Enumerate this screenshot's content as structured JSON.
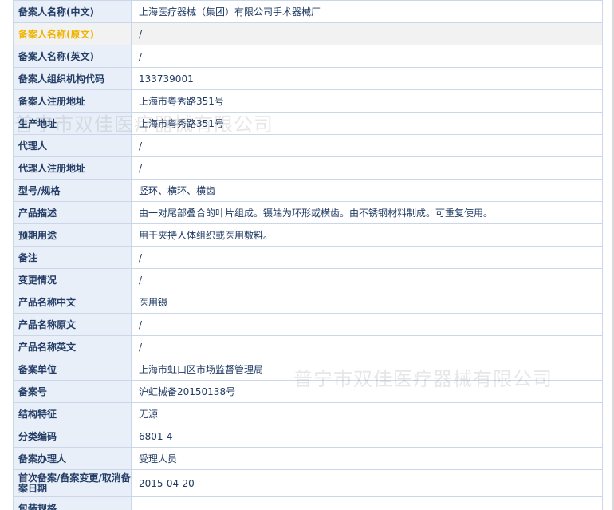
{
  "rows": [
    {
      "label": "备案人名称(中文)",
      "value": "上海医疗器械（集团）有限公司手术器械厂",
      "highlight": false
    },
    {
      "label": "备案人名称(原文)",
      "value": "/",
      "highlight": true
    },
    {
      "label": "备案人名称(英文)",
      "value": "/",
      "highlight": false
    },
    {
      "label": "备案人组织机构代码",
      "value": "133739001",
      "highlight": false
    },
    {
      "label": "备案人注册地址",
      "value": "上海市粤秀路351号",
      "highlight": false
    },
    {
      "label": "生产地址",
      "value": "上海市粤秀路351号",
      "highlight": false
    },
    {
      "label": "代理人",
      "value": "/",
      "highlight": false
    },
    {
      "label": "代理人注册地址",
      "value": "/",
      "highlight": false
    },
    {
      "label": "型号/规格",
      "value": "竖环、横环、横齿",
      "highlight": false
    },
    {
      "label": "产品描述",
      "value": "由一对尾部叠合的叶片组成。镊端为环形或横齿。由不锈钢材料制成。可重复使用。",
      "highlight": false
    },
    {
      "label": "预期用途",
      "value": "用于夹持人体组织或医用敷料。",
      "highlight": false
    },
    {
      "label": "备注",
      "value": "/",
      "highlight": false
    },
    {
      "label": "变更情况",
      "value": "/",
      "highlight": false
    },
    {
      "label": "产品名称中文",
      "value": "医用镊",
      "highlight": false
    },
    {
      "label": "产品名称原文",
      "value": "/",
      "highlight": false
    },
    {
      "label": "产品名称英文",
      "value": "/",
      "highlight": false
    },
    {
      "label": "备案单位",
      "value": "上海市虹口区市场监督管理局",
      "highlight": false
    },
    {
      "label": "备案号",
      "value": "沪虹械备20150138号",
      "highlight": false
    },
    {
      "label": "结构特征",
      "value": "无源",
      "highlight": false
    },
    {
      "label": "分类编码",
      "value": "6801-4",
      "highlight": false
    },
    {
      "label": "备案办理人",
      "value": "受理人员",
      "highlight": false
    },
    {
      "label": "首次备案/备案变更/取消备案日期",
      "value": "2015-04-20",
      "highlight": false,
      "tall": true
    },
    {
      "label": "包装规格",
      "value": "",
      "highlight": false
    }
  ],
  "watermark": {
    "text_top": "普宁市双佳医疗器械有限公司",
    "text_bottom": "普宁市双佳医疗器械有限公司"
  }
}
